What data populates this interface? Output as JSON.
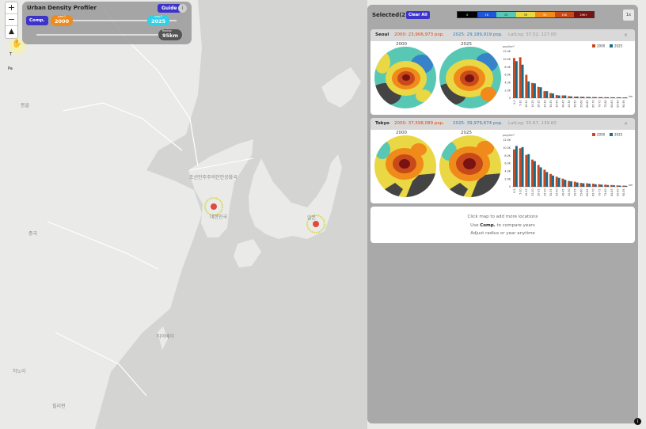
{
  "map": {
    "labels": {
      "north_korea": "조선민주주의인민공화국",
      "south_korea": "대한민국",
      "japan": "일본",
      "china": "중국",
      "mongolia": "몽골",
      "taipei": "타이베이",
      "hanoi": "하노이",
      "manila": "필리핀",
      "side_t": "T",
      "side_p": "Pa"
    },
    "zoom_in": "+",
    "zoom_out": "−",
    "compass": "▲"
  },
  "controls": {
    "title": "Urban Density Profiler",
    "guide": "Guide",
    "info": "i",
    "comp": "Comp.",
    "year1_label": "year1",
    "year1": "2000",
    "year2_label": "year2",
    "year2": "2025",
    "radius_label": "Radius",
    "radius": "95km"
  },
  "panel": {
    "title": "Selected(2)",
    "clear_all": "Clear All",
    "speed": "1x",
    "legend": [
      {
        "label": "0",
        "color": "#000000"
      },
      {
        "label": "1K",
        "color": "#1f55d9"
      },
      {
        "label": "2K",
        "color": "#58c7b4"
      },
      {
        "label": "3K",
        "color": "#e9d743"
      },
      {
        "label": "5K",
        "color": "#f08a1b"
      },
      {
        "label": "10K",
        "color": "#c84a1a"
      },
      {
        "label": "20K+",
        "color": "#7a1212"
      }
    ]
  },
  "cards": [
    {
      "city": "Seoul",
      "pop2000": "2000: 23,906,973 pop.",
      "pop2025": "2025: 29,189,919 pop.",
      "latlng": "LatLng: 37.52, 127.00",
      "year_a": "2000",
      "year_b": "2025",
      "close": "×"
    },
    {
      "city": "Tokyo",
      "pop2000": "2000: 37,598,089 pop.",
      "pop2025": "2025: 39,979,674 pop.",
      "latlng": "LatLng: 35.67, 139.60",
      "year_a": "2000",
      "year_b": "2025",
      "close": "×"
    }
  ],
  "info": {
    "line1": "Click map to add more locations",
    "line2_pre": "Use ",
    "line2_bold": "Comp.",
    "line2_post": " to compare years",
    "line3": "Adjust radius or year anytime"
  },
  "chart_data": [
    {
      "type": "bar",
      "title": "Seoul",
      "ylabel": "pop/km²",
      "xlabel": "km",
      "ylim": [
        0,
        12000
      ],
      "yticks": [
        "0",
        "2.0K",
        "4.0K",
        "6.0K",
        "8.0K",
        "10.0K",
        "12.0K"
      ],
      "categories": [
        "0-5",
        "5-10",
        "10-15",
        "15-20",
        "20-25",
        "25-30",
        "30-35",
        "35-40",
        "40-45",
        "45-50",
        "50-55",
        "55-60",
        "60-65",
        "65-70",
        "70-75",
        "75-80",
        "80-85",
        "85-90",
        "90-95"
      ],
      "series": [
        {
          "name": "2000",
          "color": "#c8471c",
          "values": [
            10300,
            10500,
            6000,
            3900,
            2900,
            1800,
            1300,
            800,
            700,
            500,
            400,
            350,
            320,
            280,
            250,
            250,
            230,
            220,
            200
          ]
        },
        {
          "name": "2025",
          "color": "#1c6a8a",
          "values": [
            9500,
            8600,
            4300,
            3800,
            2800,
            1800,
            1200,
            700,
            700,
            450,
            400,
            330,
            300,
            270,
            240,
            230,
            220,
            210,
            200
          ]
        }
      ]
    },
    {
      "type": "bar",
      "title": "Tokyo",
      "ylabel": "pop/km²",
      "xlabel": "km",
      "ylim": [
        0,
        12000
      ],
      "yticks": [
        "0",
        "2.0K",
        "4.0K",
        "6.0K",
        "8.0K",
        "10.0K",
        "12.0K"
      ],
      "categories": [
        "0-5",
        "5-10",
        "10-15",
        "15-20",
        "20-25",
        "25-30",
        "30-35",
        "35-40",
        "40-45",
        "45-50",
        "50-55",
        "55-60",
        "60-65",
        "65-70",
        "70-75",
        "75-80",
        "80-85",
        "85-90",
        "90-95"
      ],
      "series": [
        {
          "name": "2000",
          "color": "#c8471c",
          "values": [
            9600,
            9900,
            8200,
            7000,
            5600,
            4400,
            3300,
            2600,
            2100,
            1500,
            1300,
            1000,
            900,
            800,
            650,
            550,
            450,
            350,
            300
          ]
        },
        {
          "name": "2025",
          "color": "#1c6a8a",
          "values": [
            10500,
            10200,
            8400,
            6600,
            5000,
            3800,
            2900,
            2300,
            1800,
            1400,
            1100,
            900,
            800,
            650,
            550,
            450,
            400,
            300,
            250
          ]
        }
      ]
    }
  ]
}
